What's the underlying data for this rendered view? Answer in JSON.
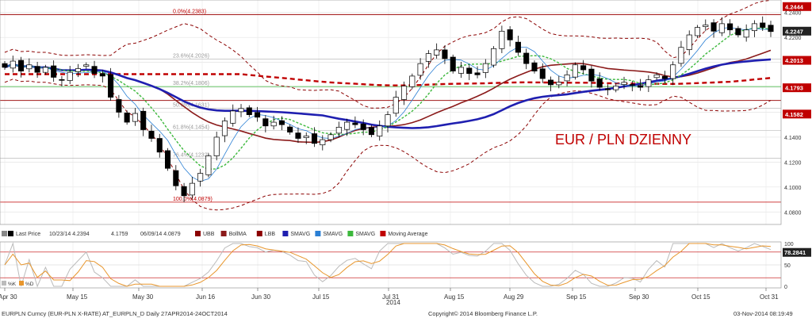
{
  "chart_data": {
    "type": "candlestick",
    "instrument": "EURPLN Curncy (EUR-PLN X-RATE) AT_EURPLN_D",
    "period": "Daily 27APR2014-24OCT2014",
    "copyright": "Copyright© 2014 Bloomberg Finance L.P.",
    "timestamp": "03-Nov-2014 08:19:49",
    "annotation": "EUR / PLN DZIENNY",
    "x_tick_labels": [
      "Apr 30",
      "May 15",
      "May 30",
      "Jun 16",
      "Jun 30",
      "Jul 15",
      "Jul 31",
      "Aug 15",
      "Aug 29",
      "Sep 15",
      "Sep 30",
      "Oct 15",
      "Oct 31"
    ],
    "year_label": "2014",
    "ylim": [
      4.07,
      4.25
    ],
    "y_ticks": [
      "4.2400",
      "4.2200",
      "4.2000",
      "4.1800",
      "4.1600",
      "4.1400",
      "4.1200",
      "4.1000",
      "4.0800"
    ],
    "price_badges": [
      {
        "value": "4.2444",
        "color": "#c00000"
      },
      {
        "value": "4.2247",
        "color": "#222222"
      },
      {
        "value": "4.2013",
        "color": "#c00000"
      },
      {
        "value": "4.1793",
        "color": "#c00000"
      },
      {
        "value": "4.1582",
        "color": "#c00000"
      }
    ],
    "fib_levels": [
      {
        "label": "0.0%(4.2383)",
        "value": 4.2383
      },
      {
        "label": "23.6%(4.2026)",
        "value": 4.2026
      },
      {
        "label": "38.2%(4.1806)",
        "value": 4.1806
      },
      {
        "label": "50.0%(4.1631)",
        "value": 4.1631
      },
      {
        "label": "61.8%(4.1454)",
        "value": 4.1454
      },
      {
        "label": "76.4%(4.1232)",
        "value": 4.1232
      },
      {
        "label": "100.0%(4.0879)",
        "value": 4.0879
      }
    ],
    "horizontal_lines": [
      4.2383,
      4.1695
    ],
    "closes": [
      4.196,
      4.201,
      4.193,
      4.198,
      4.192,
      4.196,
      4.188,
      4.186,
      4.192,
      4.195,
      4.198,
      4.191,
      4.189,
      4.172,
      4.16,
      4.152,
      4.159,
      4.146,
      4.139,
      4.128,
      4.115,
      4.101,
      4.093,
      4.103,
      4.111,
      4.125,
      4.14,
      4.153,
      4.161,
      4.163,
      4.158,
      4.156,
      4.149,
      4.152,
      4.15,
      4.144,
      4.139,
      4.141,
      4.135,
      4.138,
      4.142,
      4.148,
      4.152,
      4.15,
      4.146,
      4.142,
      4.149,
      4.158,
      4.172,
      4.181,
      4.189,
      4.199,
      4.207,
      4.21,
      4.203,
      4.193,
      4.196,
      4.191,
      4.19,
      4.199,
      4.211,
      4.225,
      4.218,
      4.208,
      4.199,
      4.193,
      4.187,
      4.182,
      4.184,
      4.19,
      4.198,
      4.194,
      4.185,
      4.18,
      4.178,
      4.181,
      4.184,
      4.182,
      4.18,
      4.186,
      4.19,
      4.187,
      4.198,
      4.212,
      4.222,
      4.228,
      4.23,
      4.225,
      4.231,
      4.226,
      4.222,
      4.226,
      4.231,
      4.228,
      4.2247
    ],
    "moving_averages": [
      {
        "name": "UBB",
        "color": "#8b0000",
        "style": "dashed"
      },
      {
        "name": "BollMA",
        "color": "#8b1a1a",
        "style": "solid"
      },
      {
        "name": "LBB",
        "color": "#8b0000",
        "style": "dashed"
      },
      {
        "name": "SMAVG",
        "color": "#1f1fb0",
        "style": "solid"
      },
      {
        "name": "SMAVG",
        "color": "#2a7fd4",
        "style": "solid"
      },
      {
        "name": "SMAVG",
        "color": "#3cb83c",
        "style": "dotted"
      },
      {
        "name": "Moving Average",
        "color": "#c00000",
        "style": "dashed"
      }
    ],
    "legend_first": "Last Price",
    "legend_ohlc": "10/23/14 4.2394",
    "legend_low": "4.1759",
    "legend_low_date": "06/09/14 4.0879",
    "rsi": {
      "ylim": [
        0,
        100
      ],
      "y_ticks": [
        "100",
        "50",
        "0"
      ],
      "value_badge": "78.2841",
      "legend": [
        "%K",
        "%D"
      ]
    }
  }
}
